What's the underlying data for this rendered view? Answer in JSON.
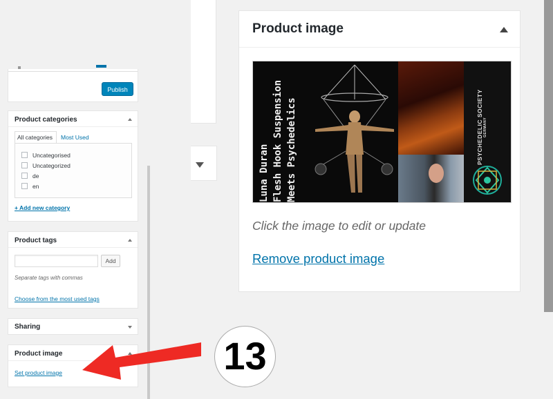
{
  "left_panel": {
    "publish_label": "Publish",
    "categories": {
      "title": "Product categories",
      "tab_all": "All categories",
      "tab_used": "Most Used",
      "items": [
        "Uncategorised",
        "Uncategorized",
        "de",
        "en"
      ],
      "add_link": "+ Add new category"
    },
    "tags": {
      "title": "Product tags",
      "input_value": "",
      "add_label": "Add",
      "hint": "Separate tags with commas",
      "choose_link": "Choose from the most used tags"
    },
    "sharing": {
      "title": "Sharing"
    },
    "product_image": {
      "title": "Product image",
      "set_link": "Set product image"
    }
  },
  "zoom_panel": {
    "title": "Product image",
    "poster": {
      "line1": "Luna Duran",
      "line2": "Flesh Hook Suspension",
      "line3": "Meets Psychedelics",
      "side": "PSYCHEDELIC SOCIETY",
      "side_small": "GERMANY"
    },
    "hint": "Click the image to edit or update",
    "remove_link": "Remove product image"
  },
  "annotation": {
    "step_number": "13",
    "arrow_color": "#ee2a24"
  }
}
